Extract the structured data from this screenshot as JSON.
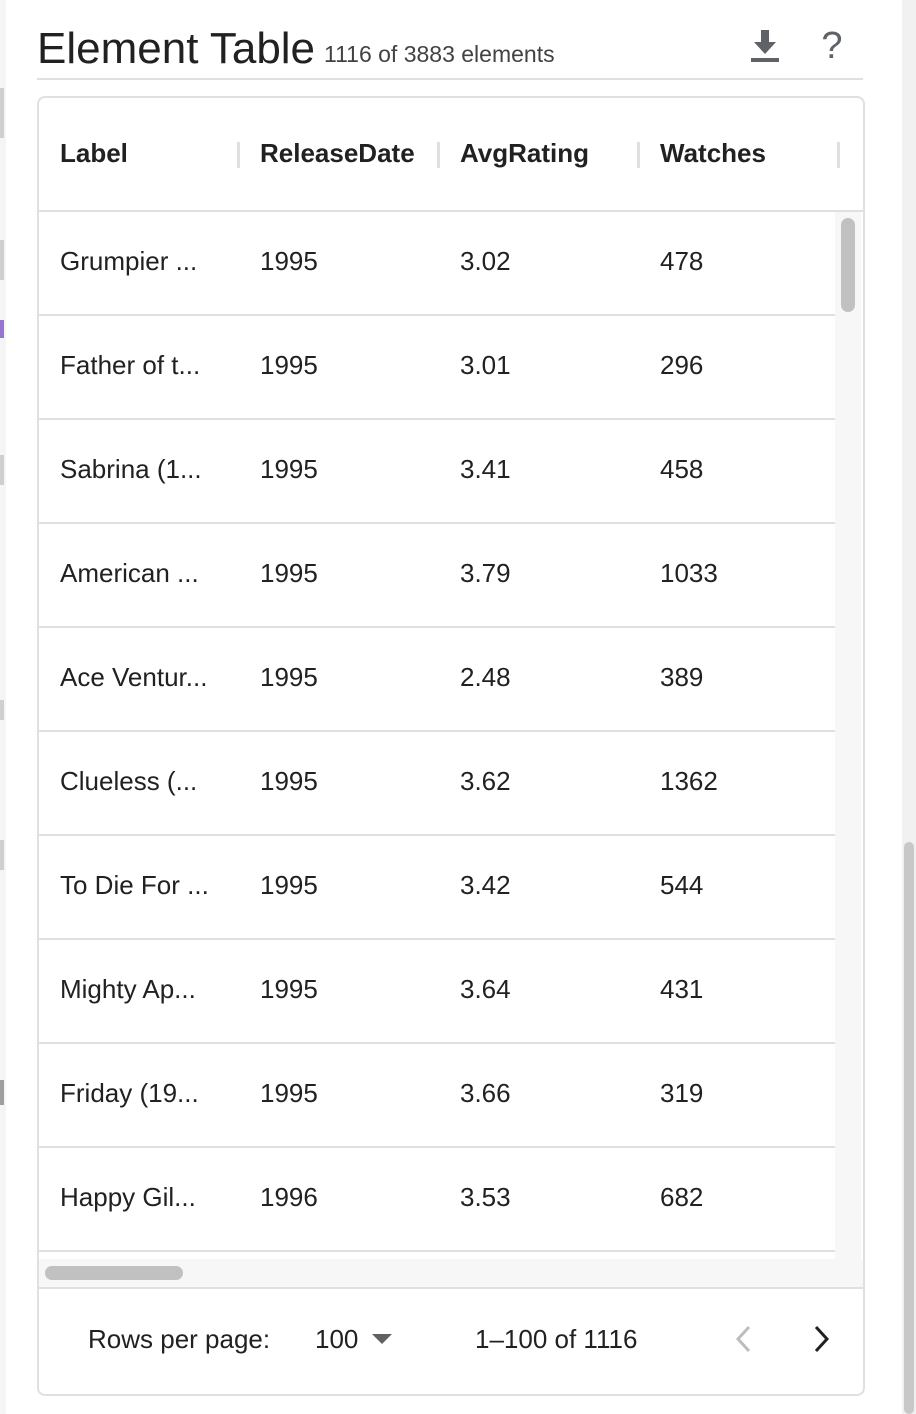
{
  "header": {
    "title": "Element Table",
    "subtitle": "1116 of 3883 elements",
    "download_icon": "download-icon",
    "help_label": "?"
  },
  "table": {
    "columns": [
      "Label",
      "ReleaseDate",
      "AvgRating",
      "Watches"
    ],
    "rows": [
      {
        "label": "Grumpier ...",
        "release": "1995",
        "rating": "3.02",
        "watches": "478"
      },
      {
        "label": "Father of t...",
        "release": "1995",
        "rating": "3.01",
        "watches": "296"
      },
      {
        "label": "Sabrina (1...",
        "release": "1995",
        "rating": "3.41",
        "watches": "458"
      },
      {
        "label": "American ...",
        "release": "1995",
        "rating": "3.79",
        "watches": "1033"
      },
      {
        "label": "Ace Ventur...",
        "release": "1995",
        "rating": "2.48",
        "watches": "389"
      },
      {
        "label": "Clueless (...",
        "release": "1995",
        "rating": "3.62",
        "watches": "1362"
      },
      {
        "label": "To Die For ...",
        "release": "1995",
        "rating": "3.42",
        "watches": "544"
      },
      {
        "label": "Mighty Ap...",
        "release": "1995",
        "rating": "3.64",
        "watches": "431"
      },
      {
        "label": "Friday (19...",
        "release": "1995",
        "rating": "3.66",
        "watches": "319"
      },
      {
        "label": "Happy Gil...",
        "release": "1996",
        "rating": "3.53",
        "watches": "682"
      }
    ]
  },
  "footer": {
    "rows_per_page_label": "Rows per page:",
    "rows_per_page_value": "100",
    "range_text": "1–100 of 1116",
    "prev_icon": "chevron-left-icon",
    "next_icon": "chevron-right-icon"
  },
  "colors": {
    "border": "#e0e0e0",
    "text": "#212121",
    "icon": "#5f6368",
    "disabled_icon": "#bdbdbd"
  }
}
